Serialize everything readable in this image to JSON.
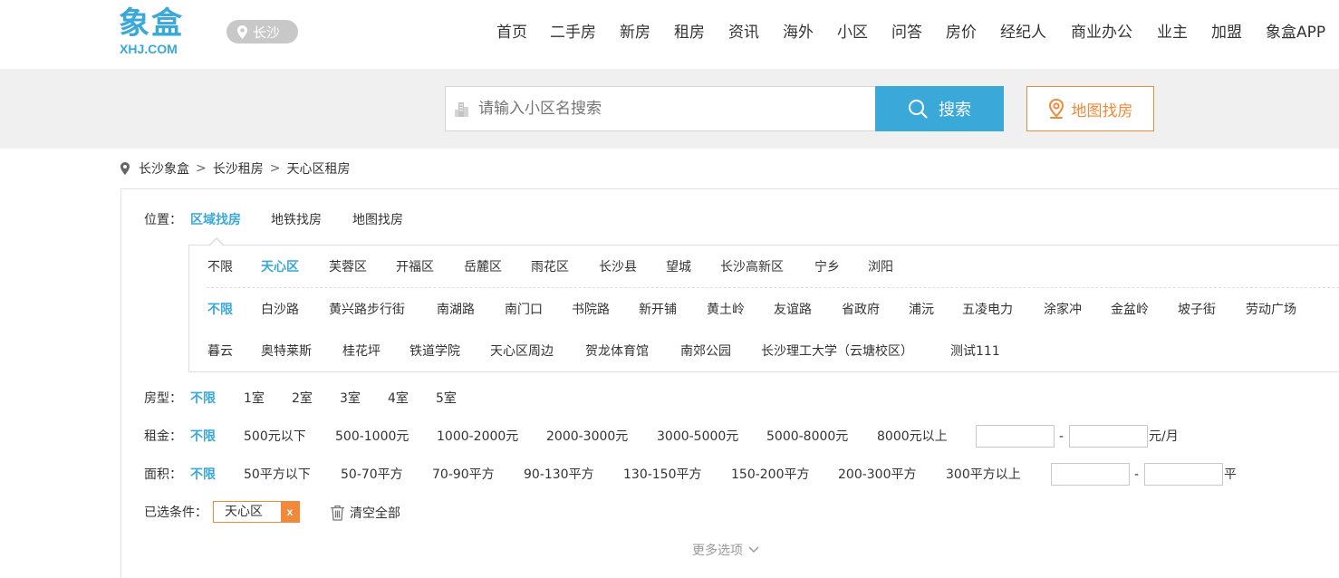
{
  "header": {
    "logo_cn": "象盒",
    "logo_en": "XHJ.COM",
    "city": "长沙",
    "nav": [
      "首页",
      "二手房",
      "新房",
      "租房",
      "资讯",
      "海外",
      "小区",
      "问答",
      "房价",
      "经纪人",
      "商业办公",
      "业主",
      "加盟",
      "象盒APP"
    ]
  },
  "search": {
    "placeholder": "请输入小区名搜索",
    "button_label": "搜索",
    "map_button_label": "地图找房"
  },
  "breadcrumb": [
    "长沙象盒",
    "长沙租房",
    "天心区租房"
  ],
  "filters": {
    "location_label": "位置：",
    "location_tabs": [
      "区域找房",
      "地铁找房",
      "地图找房"
    ],
    "districts": [
      "不限",
      "天心区",
      "芙蓉区",
      "开福区",
      "岳麓区",
      "雨花区",
      "长沙县",
      "望城",
      "长沙高新区",
      "宁乡",
      "浏阳"
    ],
    "areas_row1": [
      "不限",
      "白沙路",
      "黄兴路步行街",
      "南湖路",
      "南门口",
      "书院路",
      "新开铺",
      "黄土岭",
      "友谊路",
      "省政府",
      "浦沅",
      "五凌电力",
      "涂家冲",
      "金盆岭",
      "坡子街",
      "劳动广场"
    ],
    "areas_row2": [
      "暮云",
      "奥特莱斯",
      "桂花坪",
      "铁道学院",
      "天心区周边",
      "贺龙体育馆",
      "南郊公园",
      "长沙理工大学（云塘校区）",
      "测试111"
    ],
    "room_label": "房型：",
    "room_options": [
      "不限",
      "1室",
      "2室",
      "3室",
      "4室",
      "5室"
    ],
    "rent_label": "租金：",
    "rent_options": [
      "不限",
      "500元以下",
      "500-1000元",
      "1000-2000元",
      "2000-3000元",
      "3000-5000元",
      "5000-8000元",
      "8000元以上"
    ],
    "rent_dash": "-",
    "rent_unit": "元/月",
    "size_label": "面积：",
    "size_options": [
      "不限",
      "50平方以下",
      "50-70平方",
      "70-90平方",
      "90-130平方",
      "130-150平方",
      "150-200平方",
      "200-300平方",
      "300平方以上"
    ],
    "size_dash": "-",
    "size_unit": "平",
    "selected_label": "已选条件：",
    "selected_tag": "天心区",
    "selected_tag_remove": "x",
    "clear_all": "清空全部",
    "more_options": "更多选项"
  },
  "colors": {
    "accent": "#3aa8d8",
    "orange": "#f08a3a"
  }
}
